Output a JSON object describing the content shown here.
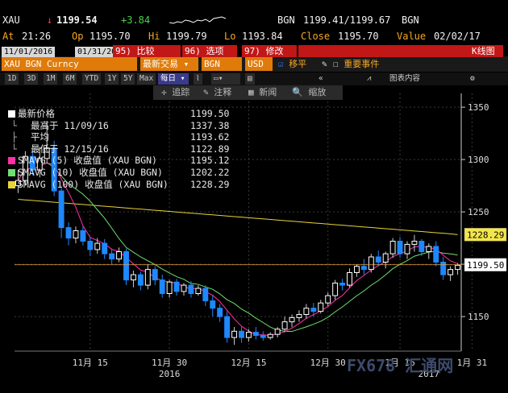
{
  "header": {
    "ticker": "XAU",
    "arrow": "↓",
    "last": "1199.54",
    "change": "+3.84",
    "source": "BGN",
    "bid_ask": "1199.41/1199.67",
    "source2": "BGN",
    "at_label": "At",
    "time": "21:26",
    "op_label": "Op",
    "open": "1195.70",
    "hi_label": "Hi",
    "high": "1199.79",
    "lo_label": "Lo",
    "low": "1193.84",
    "close_label": "Close",
    "close": "1195.70",
    "value_label": "Value",
    "date": "02/02/17"
  },
  "toolbar": {
    "start_date": "11/01/2016",
    "end_date": "01/31/2017",
    "compare_num": "95)",
    "compare": "比较",
    "options_num": "96)",
    "options": "选项",
    "edit_num": "97)",
    "edit": "修改",
    "chart_type": "K线图",
    "security": "XAU BGN Curncy",
    "event_type": "最新交易",
    "source": "BGN",
    "currency": "USD",
    "shift_label": "移平",
    "events_label": "重要事件"
  },
  "periods": [
    "1D",
    "3D",
    "1M",
    "6M",
    "YTD",
    "1Y",
    "5Y",
    "Max"
  ],
  "period_select": "每日",
  "chart_tools": {
    "track": "追踪",
    "annotate": "注释",
    "news": "新闻",
    "zoom": "缩放",
    "chart_content": "图表内容"
  },
  "legend": {
    "last_price_label": "最新价格",
    "last_price": "1199.50",
    "high_label": "最高于 11/09/16",
    "high": "1337.38",
    "avg_label": "平均",
    "avg": "1193.62",
    "low_label": "最低于 12/15/16",
    "low": "1122.89",
    "sma5_label": "SMAVG (5) 收盘值 (XAU BGN)",
    "sma5": "1195.12",
    "sma10_label": "SMAVG (10) 收盘值 (XAU BGN)",
    "sma10": "1202.22",
    "sma100_label": "SMAVG (100) 收盘值 (XAU BGN)",
    "sma100": "1228.29"
  },
  "colors": {
    "up": "#ffffff",
    "down": "#1e88ff",
    "sma5": "#ff2fa8",
    "sma10": "#6fe06f",
    "sma100": "#e8d23a",
    "last_tag": "#ffffff",
    "sma100_tag": "#f4e64a"
  },
  "watermark": "FX678 汇通网",
  "chart_data": {
    "type": "candlestick",
    "y_ticks": [
      1150,
      1200,
      1250,
      1300,
      1350
    ],
    "ylim": [
      1117,
      1357
    ],
    "x_tick_labels": [
      {
        "label": "11月 15",
        "idx": 10
      },
      {
        "label": "11月 30",
        "idx": 21
      },
      {
        "label": "12月 15",
        "idx": 32
      },
      {
        "label": "12月 30",
        "idx": 43
      },
      {
        "label": "1月 16",
        "idx": 53
      },
      {
        "label": "1月 31",
        "idx": 63
      }
    ],
    "year_labels": [
      {
        "label": "2016",
        "idx": 21
      },
      {
        "label": "2017",
        "idx": 57
      }
    ],
    "last_price_tag": "1199.50",
    "sma100_tag": "1228.29",
    "candles": [
      [
        1275,
        1290,
        1268,
        1280
      ],
      [
        1280,
        1308,
        1275,
        1303
      ],
      [
        1303,
        1308,
        1285,
        1290
      ],
      [
        1290,
        1312,
        1283,
        1301
      ],
      [
        1301,
        1337,
        1296,
        1311
      ],
      [
        1311,
        1318,
        1265,
        1270
      ],
      [
        1270,
        1275,
        1225,
        1235
      ],
      [
        1235,
        1240,
        1218,
        1225
      ],
      [
        1225,
        1236,
        1220,
        1232
      ],
      [
        1232,
        1236,
        1218,
        1222
      ],
      [
        1222,
        1226,
        1208,
        1214
      ],
      [
        1214,
        1225,
        1210,
        1220
      ],
      [
        1220,
        1224,
        1205,
        1210
      ],
      [
        1210,
        1215,
        1200,
        1205
      ],
      [
        1205,
        1216,
        1202,
        1212
      ],
      [
        1212,
        1215,
        1180,
        1185
      ],
      [
        1185,
        1194,
        1178,
        1190
      ],
      [
        1190,
        1193,
        1175,
        1180
      ],
      [
        1180,
        1200,
        1176,
        1195
      ],
      [
        1195,
        1198,
        1180,
        1185
      ],
      [
        1185,
        1190,
        1168,
        1172
      ],
      [
        1172,
        1185,
        1168,
        1183
      ],
      [
        1183,
        1186,
        1170,
        1174
      ],
      [
        1174,
        1182,
        1170,
        1180
      ],
      [
        1180,
        1184,
        1168,
        1172
      ],
      [
        1172,
        1180,
        1170,
        1177
      ],
      [
        1177,
        1180,
        1160,
        1165
      ],
      [
        1165,
        1170,
        1150,
        1158
      ],
      [
        1158,
        1162,
        1145,
        1150
      ],
      [
        1150,
        1155,
        1125,
        1130
      ],
      [
        1130,
        1140,
        1123,
        1136
      ],
      [
        1136,
        1140,
        1125,
        1130
      ],
      [
        1130,
        1138,
        1126,
        1135
      ],
      [
        1135,
        1140,
        1128,
        1132
      ],
      [
        1132,
        1136,
        1127,
        1130
      ],
      [
        1130,
        1135,
        1128,
        1133
      ],
      [
        1133,
        1140,
        1130,
        1138
      ],
      [
        1138,
        1150,
        1135,
        1145
      ],
      [
        1145,
        1152,
        1140,
        1149
      ],
      [
        1149,
        1156,
        1145,
        1152
      ],
      [
        1152,
        1162,
        1148,
        1158
      ],
      [
        1158,
        1163,
        1150,
        1155
      ],
      [
        1155,
        1166,
        1153,
        1163
      ],
      [
        1163,
        1173,
        1160,
        1170
      ],
      [
        1170,
        1185,
        1166,
        1182
      ],
      [
        1182,
        1186,
        1175,
        1180
      ],
      [
        1180,
        1196,
        1178,
        1192
      ],
      [
        1192,
        1200,
        1188,
        1198
      ],
      [
        1198,
        1205,
        1190,
        1195
      ],
      [
        1195,
        1210,
        1192,
        1207
      ],
      [
        1207,
        1213,
        1198,
        1202
      ],
      [
        1202,
        1212,
        1196,
        1210
      ],
      [
        1210,
        1225,
        1206,
        1222
      ],
      [
        1222,
        1226,
        1206,
        1210
      ],
      [
        1210,
        1222,
        1205,
        1219
      ],
      [
        1219,
        1228,
        1212,
        1222
      ],
      [
        1222,
        1224,
        1208,
        1212
      ],
      [
        1212,
        1220,
        1205,
        1217
      ],
      [
        1217,
        1222,
        1198,
        1202
      ],
      [
        1202,
        1207,
        1185,
        1190
      ],
      [
        1190,
        1198,
        1184,
        1195
      ],
      [
        1195,
        1201,
        1190,
        1199
      ]
    ]
  }
}
